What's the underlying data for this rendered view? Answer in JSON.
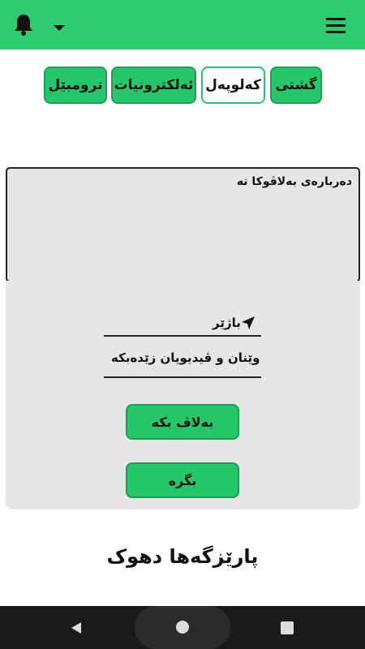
{
  "header": {
    "bell_icon": "bell-icon",
    "dropdown_icon": "caret-down-icon",
    "menu_icon": "hamburger-menu-icon"
  },
  "tabs": [
    {
      "label": "گشتی",
      "active": false
    },
    {
      "label": "کەلوپەل",
      "active": true
    },
    {
      "label": "ئەلکترونیات",
      "active": false
    },
    {
      "label": "ترومبێل",
      "active": false
    }
  ],
  "ad_form": {
    "about_label": "دەربارەی بەلاڤوکا تە",
    "city_label": "باژێر",
    "media_label": "وێنان و ڤیدیویان زێدەبکە",
    "publish_button": "بەلاڤ بکە",
    "search_button": "بگرە"
  },
  "footer": {
    "title": "پارێزگەها دهوک"
  },
  "colors": {
    "accent": "#2ecc71",
    "button": "#26c76b",
    "panel": "#e6e6e6"
  }
}
